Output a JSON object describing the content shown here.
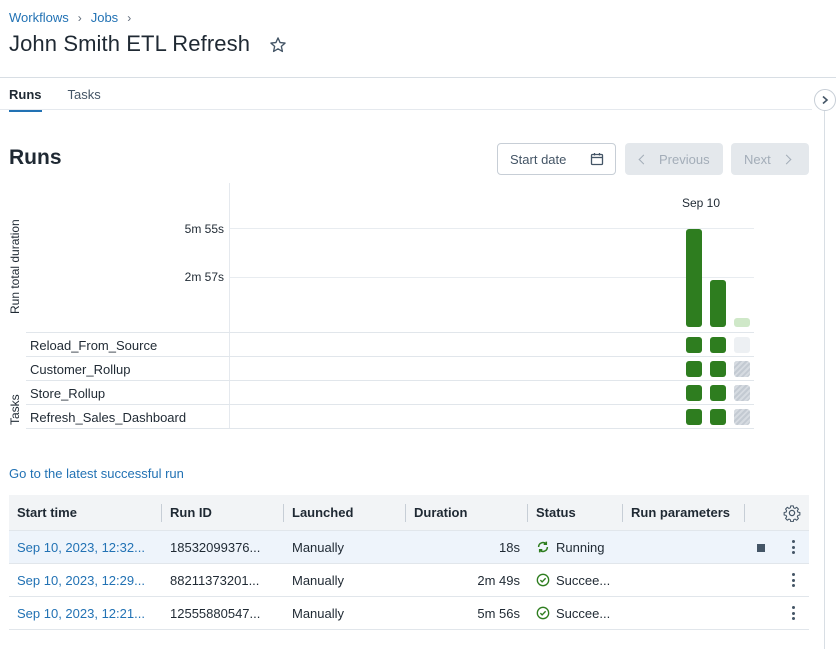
{
  "breadcrumb": [
    "Workflows",
    "Jobs"
  ],
  "page": {
    "title": "John Smith ETL Refresh"
  },
  "tabs": [
    {
      "label": "Runs",
      "active": true
    },
    {
      "label": "Tasks",
      "active": false
    }
  ],
  "runs": {
    "title": "Runs",
    "start_date_placeholder": "Start date",
    "previous_label": "Previous",
    "next_label": "Next",
    "latest_link": "Go to the latest successful run"
  },
  "chart_data": {
    "type": "bar",
    "ylabel": "Run total duration",
    "task_axis_label": "Tasks",
    "x_group_label": "Sep 10",
    "y_ticks": [
      "5m 55s",
      "2m 57s"
    ],
    "runs": [
      {
        "duration_seconds": 356,
        "status": "succeeded"
      },
      {
        "duration_seconds": 169,
        "status": "succeeded"
      },
      {
        "duration_seconds": 18,
        "status": "running"
      }
    ],
    "tasks": [
      "Reload_From_Source",
      "Customer_Rollup",
      "Store_Rollup",
      "Refresh_Sales_Dashboard"
    ],
    "task_status": [
      [
        "succeeded",
        "succeeded",
        "pending"
      ],
      [
        "succeeded",
        "succeeded",
        "blocked"
      ],
      [
        "succeeded",
        "succeeded",
        "blocked"
      ],
      [
        "succeeded",
        "succeeded",
        "blocked"
      ]
    ]
  },
  "table": {
    "columns": [
      "Start time",
      "Run ID",
      "Launched",
      "Duration",
      "Status",
      "Run parameters"
    ],
    "rows": [
      {
        "start": "Sep 10, 2023, 12:32...",
        "run_id": "18532099376...",
        "launched": "Manually",
        "duration": "18s",
        "status": "Running"
      },
      {
        "start": "Sep 10, 2023, 12:29...",
        "run_id": "88211373201...",
        "launched": "Manually",
        "duration": "2m 49s",
        "status": "Succee..."
      },
      {
        "start": "Sep 10, 2023, 12:21...",
        "run_id": "12555880547...",
        "launched": "Manually",
        "duration": "5m 56s",
        "status": "Succee..."
      }
    ]
  },
  "colors": {
    "accent": "#2272b4",
    "success": "#2e7d1f",
    "running_bar": "#cfe8c8"
  }
}
